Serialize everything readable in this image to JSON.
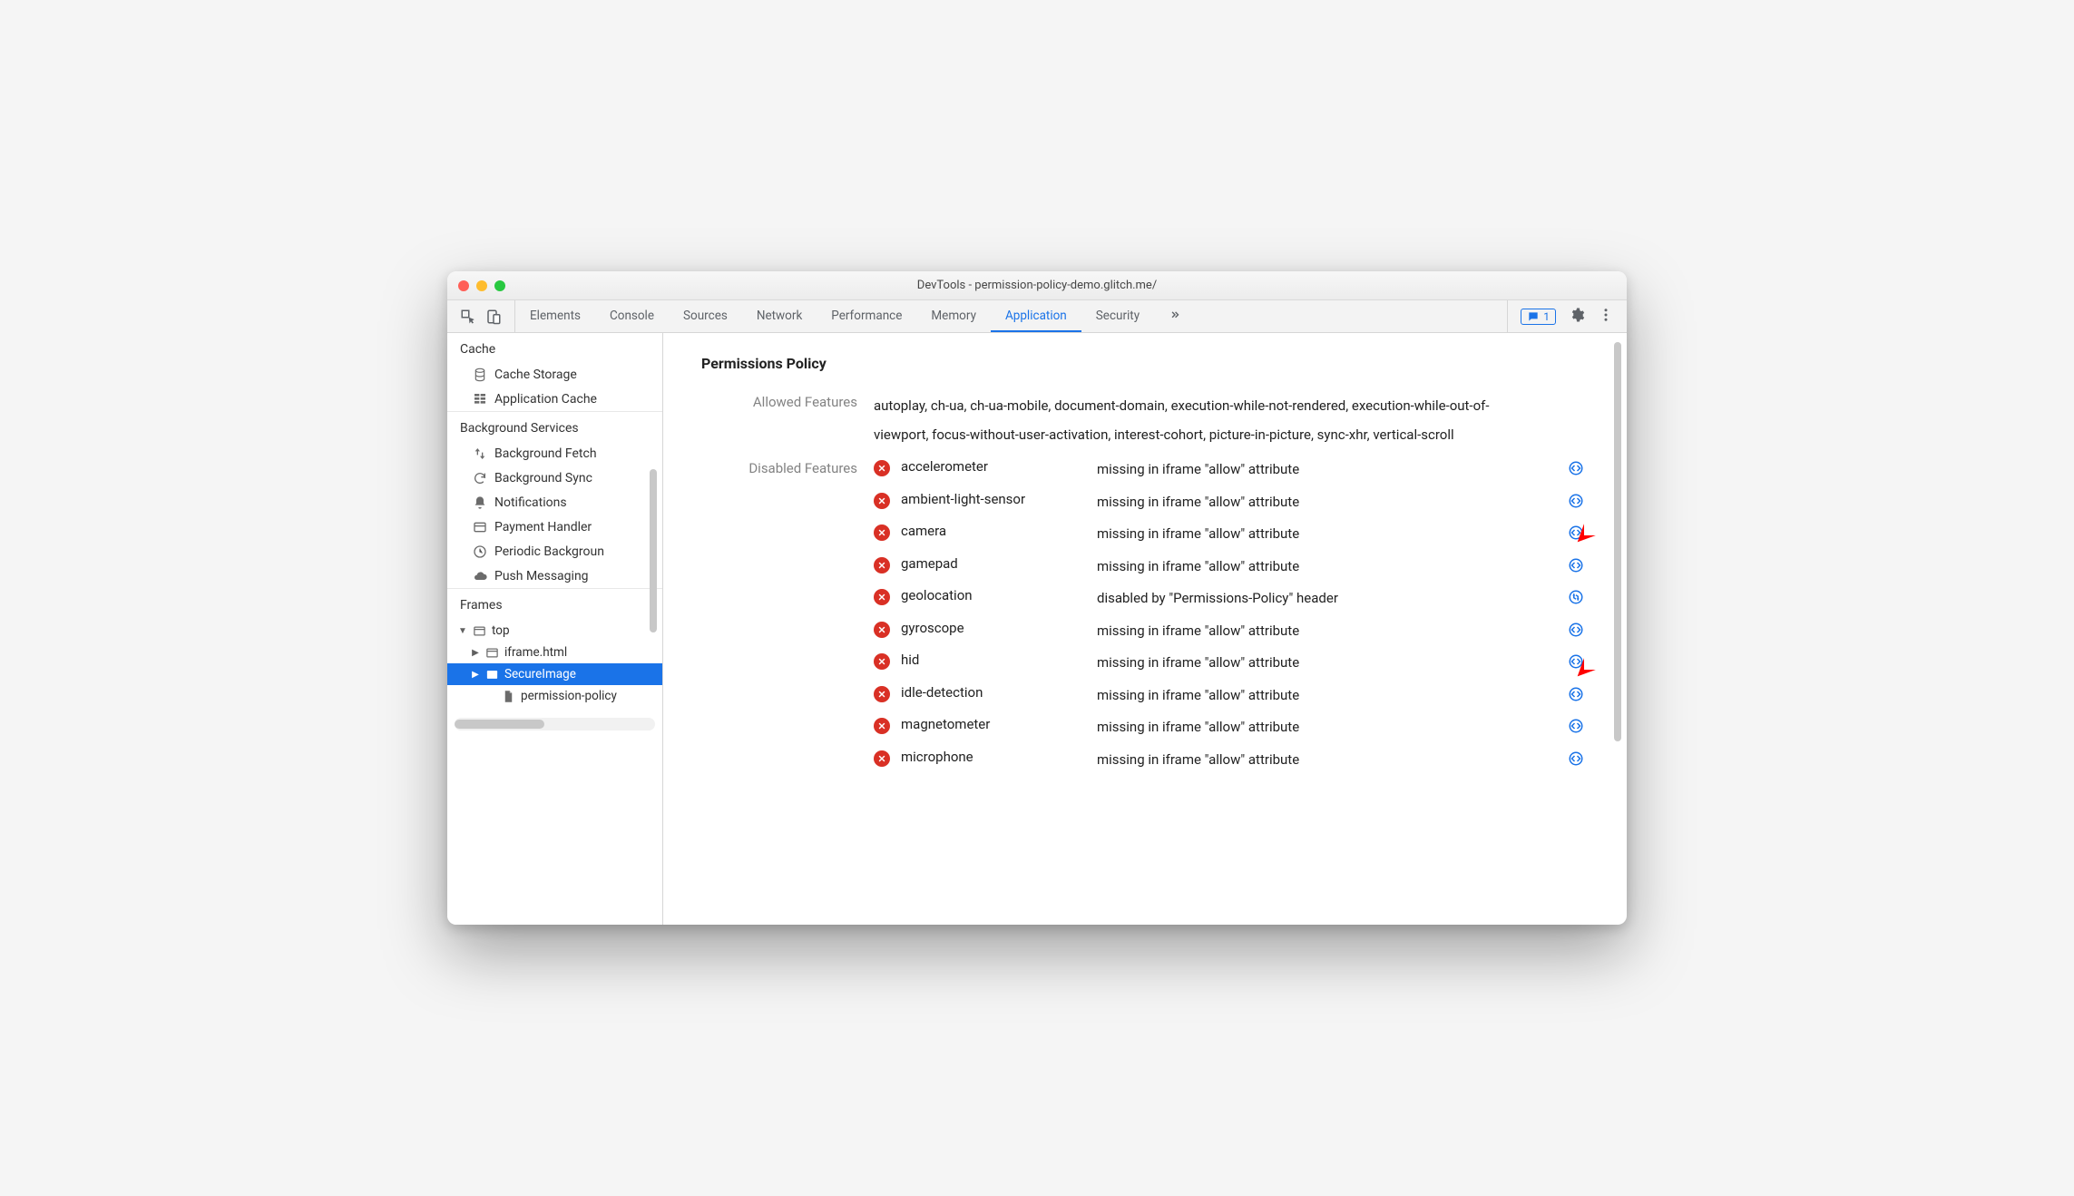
{
  "window": {
    "title": "DevTools - permission-policy-demo.glitch.me/"
  },
  "toolbar": {
    "tabs": [
      "Elements",
      "Console",
      "Sources",
      "Network",
      "Performance",
      "Memory",
      "Application",
      "Security"
    ],
    "active_tab": "Application",
    "issues_count": "1"
  },
  "sidebar": {
    "sections": [
      {
        "label": "Cache",
        "items": [
          {
            "icon": "database-icon",
            "label": "Cache Storage"
          },
          {
            "icon": "grid-icon",
            "label": "Application Cache"
          }
        ]
      },
      {
        "label": "Background Services",
        "items": [
          {
            "icon": "updown-icon",
            "label": "Background Fetch"
          },
          {
            "icon": "sync-icon",
            "label": "Background Sync"
          },
          {
            "icon": "bell-icon",
            "label": "Notifications"
          },
          {
            "icon": "card-icon",
            "label": "Payment Handler"
          },
          {
            "icon": "clock-icon",
            "label": "Periodic Backgroun"
          },
          {
            "icon": "cloud-icon",
            "label": "Push Messaging"
          }
        ]
      }
    ],
    "frames_label": "Frames",
    "frames": {
      "top": {
        "label": "top",
        "children": [
          {
            "label": "iframe.html",
            "selected": false
          },
          {
            "label": "SecureImage",
            "selected": true
          },
          {
            "label": "permission-policy",
            "selected": false,
            "leaf": true
          }
        ]
      }
    }
  },
  "main": {
    "title": "Permissions Policy",
    "allowed_label": "Allowed Features",
    "allowed_value": "autoplay, ch-ua, ch-ua-mobile, document-domain, execution-while-not-rendered, execution-while-out-of-viewport, focus-without-user-activation, interest-cohort, picture-in-picture, sync-xhr, vertical-scroll",
    "disabled_label": "Disabled Features",
    "disabled_features": [
      {
        "name": "accelerometer",
        "reason": "missing in iframe \"allow\" attribute",
        "action": "code"
      },
      {
        "name": "ambient-light-sensor",
        "reason": "missing in iframe \"allow\" attribute",
        "action": "code"
      },
      {
        "name": "camera",
        "reason": "missing in iframe \"allow\" attribute",
        "action": "code"
      },
      {
        "name": "gamepad",
        "reason": "missing in iframe \"allow\" attribute",
        "action": "code"
      },
      {
        "name": "geolocation",
        "reason": "disabled by \"Permissions-Policy\" header",
        "action": "network"
      },
      {
        "name": "gyroscope",
        "reason": "missing in iframe \"allow\" attribute",
        "action": "code"
      },
      {
        "name": "hid",
        "reason": "missing in iframe \"allow\" attribute",
        "action": "code"
      },
      {
        "name": "idle-detection",
        "reason": "missing in iframe \"allow\" attribute",
        "action": "code"
      },
      {
        "name": "magnetometer",
        "reason": "missing in iframe \"allow\" attribute",
        "action": "code"
      },
      {
        "name": "microphone",
        "reason": "missing in iframe \"allow\" attribute",
        "action": "code"
      }
    ]
  }
}
